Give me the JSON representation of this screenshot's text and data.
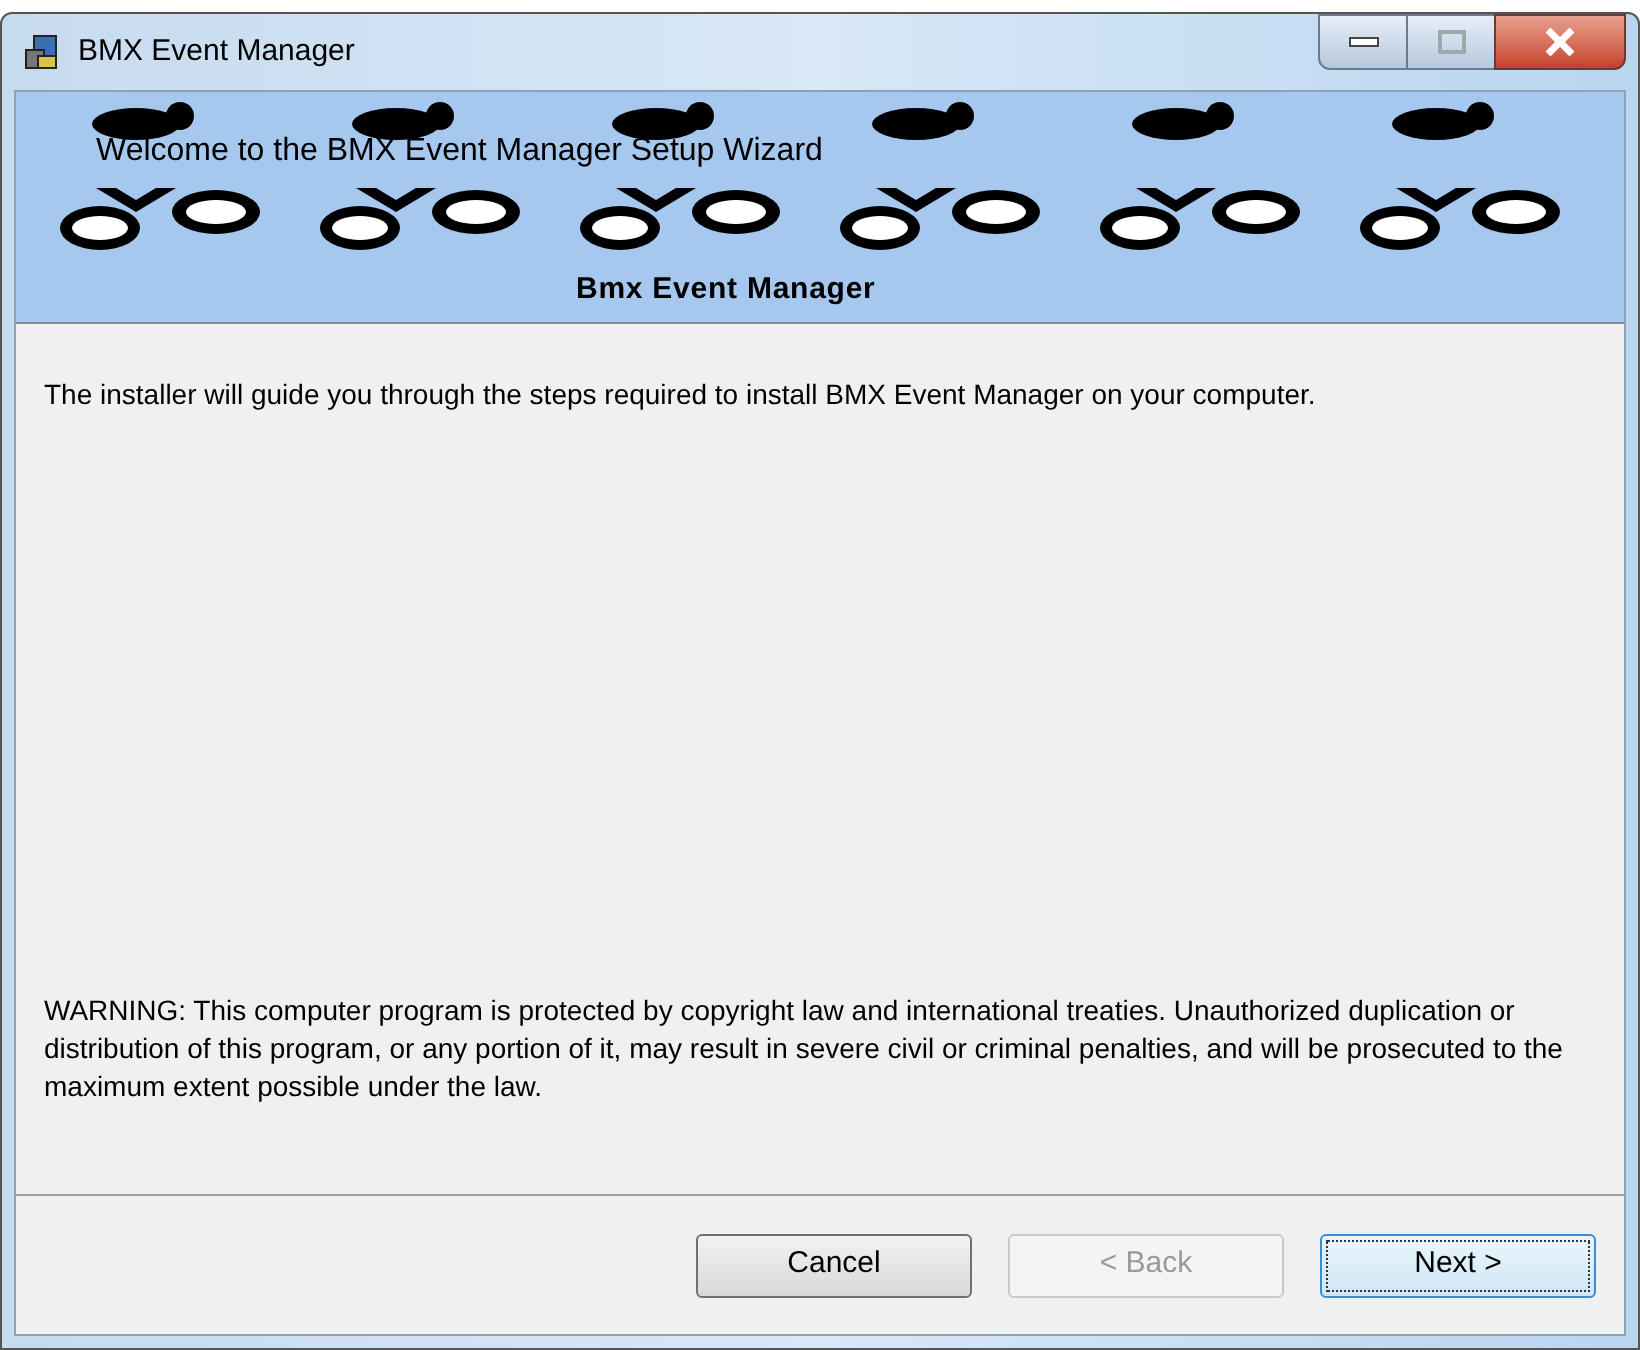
{
  "window": {
    "title": "BMX Event Manager"
  },
  "banner": {
    "heading": "Welcome to the BMX Event Manager Setup Wizard",
    "logo_text": "Bmx Event Manager"
  },
  "intro": "The installer will guide you through the steps required to install BMX Event Manager on your computer.",
  "warning": "WARNING: This computer program is protected by copyright law and international treaties. Unauthorized duplication or distribution of this program, or any portion of it, may result in severe civil or criminal penalties, and will be prosecuted to the maximum extent possible under the law.",
  "buttons": [
    {
      "label": "Cancel",
      "disabled": false,
      "focused": false
    },
    {
      "label": "< Back",
      "disabled": true,
      "focused": false
    },
    {
      "label": "Next >",
      "disabled": false,
      "focused": true
    }
  ]
}
